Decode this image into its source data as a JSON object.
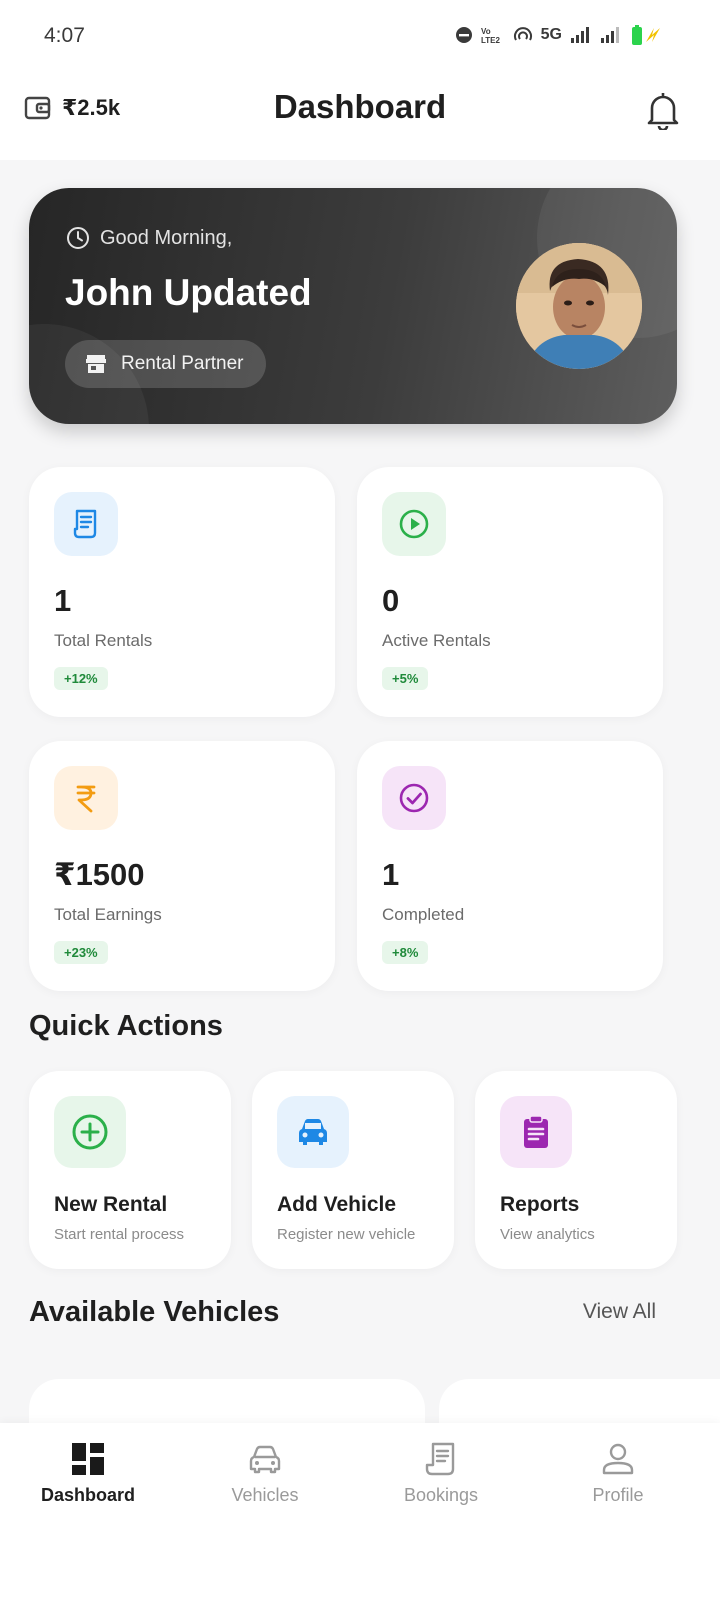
{
  "status_bar": {
    "time": "4:07",
    "network": "5G"
  },
  "header": {
    "wallet_amount": "₹2.5k",
    "title": "Dashboard"
  },
  "hero": {
    "greeting": "Good Morning,",
    "name": "John Updated",
    "role": "Rental Partner"
  },
  "stats": [
    {
      "value": "1",
      "label": "Total Rentals",
      "change": "+12%",
      "icon": "receipt-icon",
      "color": "#1e88e5"
    },
    {
      "value": "0",
      "label": "Active Rentals",
      "change": "+5%",
      "icon": "play-circle-icon",
      "color": "#2bb04a"
    },
    {
      "value": "₹1500",
      "label": "Total Earnings",
      "change": "+23%",
      "icon": "rupee-icon",
      "color": "#f39c12"
    },
    {
      "value": "1",
      "label": "Completed",
      "change": "+8%",
      "icon": "check-circle-icon",
      "color": "#9c27b0"
    }
  ],
  "quick_actions": {
    "title": "Quick Actions",
    "items": [
      {
        "title": "New Rental",
        "subtitle": "Start rental process",
        "icon": "add-circle-icon"
      },
      {
        "title": "Add Vehicle",
        "subtitle": "Register new vehicle",
        "icon": "car-icon"
      },
      {
        "title": "Reports",
        "subtitle": "View analytics",
        "icon": "clipboard-icon"
      }
    ]
  },
  "available_vehicles": {
    "title": "Available Vehicles",
    "view_all": "View All"
  },
  "bottom_nav": [
    {
      "label": "Dashboard",
      "icon": "dashboard-icon",
      "active": true
    },
    {
      "label": "Vehicles",
      "icon": "car-icon",
      "active": false
    },
    {
      "label": "Bookings",
      "icon": "receipt-icon",
      "active": false
    },
    {
      "label": "Profile",
      "icon": "person-icon",
      "active": false
    }
  ]
}
